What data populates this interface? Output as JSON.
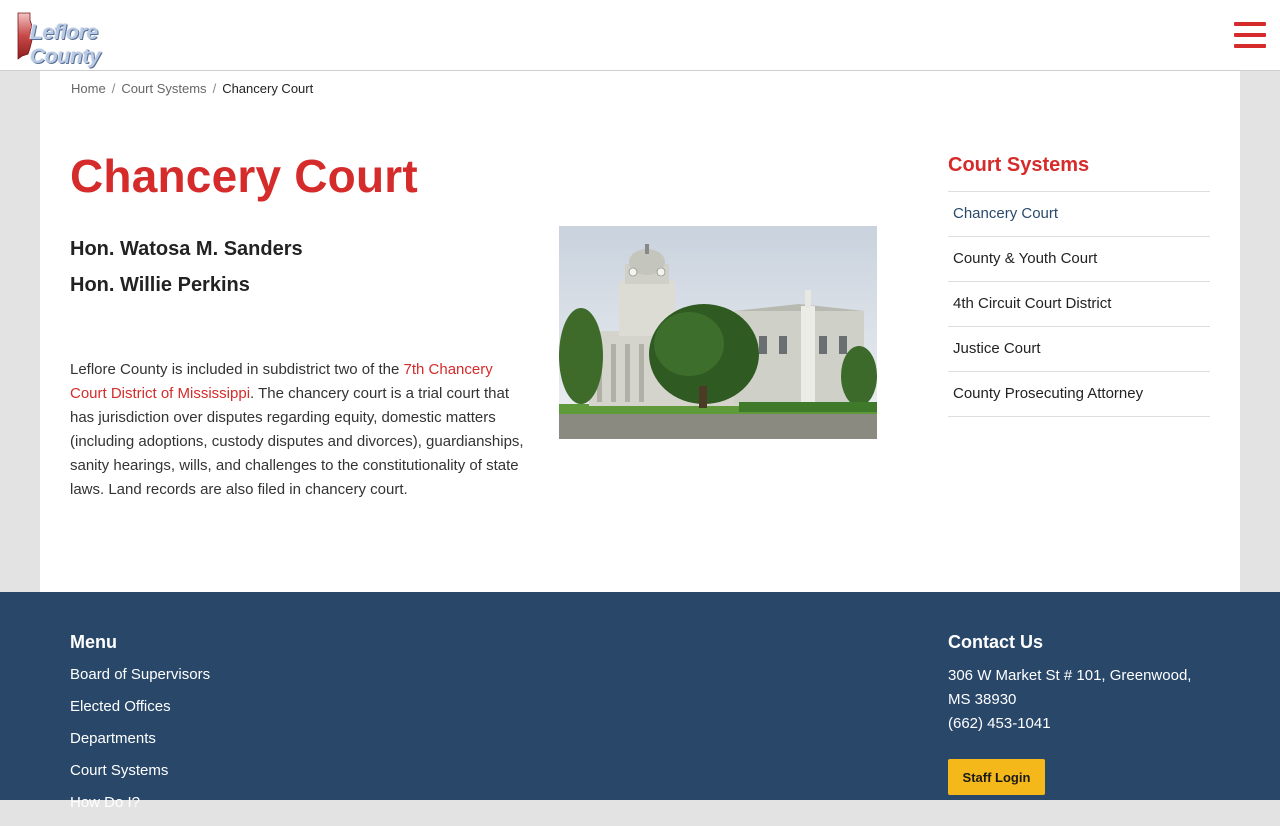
{
  "header": {
    "logo_text": "Leflore County",
    "menu_icon": "hamburger-menu-icon",
    "accent_color": "#d52b2b"
  },
  "breadcrumb": {
    "home": "Home",
    "parent": "Court Systems",
    "current": "Chancery Court",
    "separator": "/"
  },
  "main": {
    "title": "Chancery Court",
    "judges": [
      "Hon. Watosa M. Sanders",
      "Hon. Willie Perkins"
    ],
    "description_intro": "Leflore County is included in subdistrict two of the ",
    "description_link": "7th Chancery Court District of Mississippi",
    "description_rest": ". The chancery court is a trial court that has jurisdiction over disputes regarding equity, domestic matters (including adoptions, custody disputes and divorces), guardianships, sanity hearings, wills, and challenges to the constitutionality of state laws. Land records are also filed in chancery court."
  },
  "sidebar": {
    "title": "Court Systems",
    "items": [
      {
        "label": "Chancery Court"
      },
      {
        "label": "County & Youth Court"
      },
      {
        "label": "4th Circuit Court District"
      },
      {
        "label": "Justice Court"
      },
      {
        "label": "County Prosecuting Attorney"
      }
    ]
  },
  "footer": {
    "menu_title": "Menu",
    "menu_items": [
      "Board of Supervisors",
      "Elected Offices",
      "Departments",
      "Court Systems",
      "How Do I?"
    ],
    "contact_title": "Contact Us",
    "address_line1": "306 W Market St # 101, Greenwood,",
    "address_line2": "MS 38930",
    "phone": "(662) 453-1041",
    "staff_login": "Staff Login",
    "background_color": "#284769",
    "button_color": "#f5b81a"
  }
}
